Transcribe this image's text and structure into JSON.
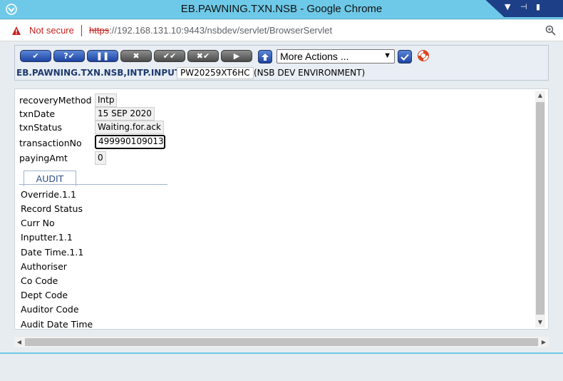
{
  "window": {
    "title": "EB.PAWNING.TXN.NSB - Google Chrome"
  },
  "addressbar": {
    "security_label": "Not secure",
    "url_scheme": "https",
    "url_rest": "://192.168.131.10:9443/nsbdev/servlet/BrowserServlet"
  },
  "toolbar": {
    "buttons": [
      {
        "name": "commit-button",
        "glyph": "✔"
      },
      {
        "name": "validate-button",
        "glyph": "?✔"
      },
      {
        "name": "hold-button",
        "glyph": "❚❚"
      },
      {
        "name": "delete-button",
        "glyph": "✖"
      },
      {
        "name": "authorise-button",
        "glyph": "✔✔"
      },
      {
        "name": "reverse-button",
        "glyph": "✖✔"
      },
      {
        "name": "next-button",
        "glyph": "▶"
      }
    ],
    "more_actions": "More Actions ...",
    "app_id": "EB.PAWNING.TXN.NSB,INTP.INPUT",
    "record_id": "PW20259XT6HC",
    "environment": "(NSB DEV ENVIRONMENT)"
  },
  "fields": [
    {
      "label": "recoveryMethod",
      "value": "Intp"
    },
    {
      "label": "txnDate",
      "value": "15 SEP 2020"
    },
    {
      "label": "txnStatus",
      "value": "Waiting.for.ack"
    },
    {
      "label": "transactionNo",
      "value": "499990109013"
    },
    {
      "label": "payingAmt",
      "value": "0"
    }
  ],
  "audit": {
    "tab_label": "AUDIT",
    "items": [
      "Override.1.1",
      "Record Status",
      "Curr No",
      "Inputter.1.1",
      "Date Time.1.1",
      "Authoriser",
      "Co Code",
      "Dept Code",
      "Auditor Code",
      "Audit Date Time"
    ]
  },
  "icons": {
    "app": "app-icon",
    "warning": "warning-icon",
    "zoom": "zoom-icon",
    "lifebuoy": "help-lifebuoy-icon"
  },
  "colors": {
    "titlebar": "#6ec9e8",
    "danger": "#c5221f",
    "button_blue": "#1e44a3",
    "label_blue": "#1f3a6e"
  }
}
